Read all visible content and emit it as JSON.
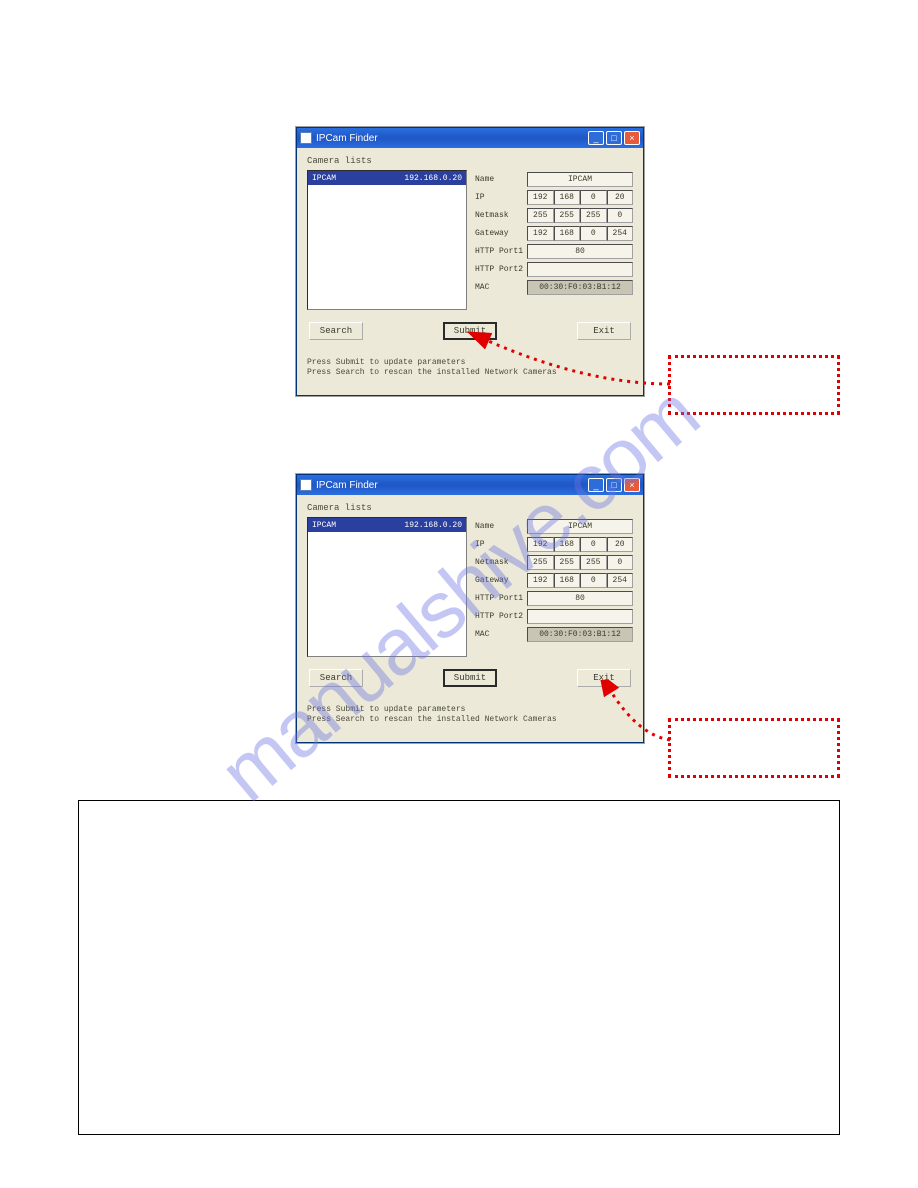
{
  "watermark": "manualshive.com",
  "window": {
    "title": "IPCam Finder",
    "camera_lists_label": "Camera lists",
    "list_item": {
      "name": "IPCAM",
      "addr": "192.168.0.20"
    },
    "labels": {
      "name": "Name",
      "ip": "IP",
      "netmask": "Netmask",
      "gateway": "Gateway",
      "port1": "HTTP Port1",
      "port2": "HTTP Port2",
      "mac": "MAC"
    },
    "values": {
      "name": "IPCAM",
      "ip": [
        "192",
        "168",
        "0",
        "20"
      ],
      "netmask": [
        "255",
        "255",
        "255",
        "0"
      ],
      "gateway": [
        "192",
        "168",
        "0",
        "254"
      ],
      "port1": "80",
      "port2": "",
      "mac": "00:30:F0:03:B1:12"
    },
    "buttons": {
      "search": "Search",
      "submit": "Submit",
      "exit": "Exit"
    },
    "hint1": "Press Submit to update parameters",
    "hint2": "Press Search to rescan the installed Network Cameras"
  }
}
